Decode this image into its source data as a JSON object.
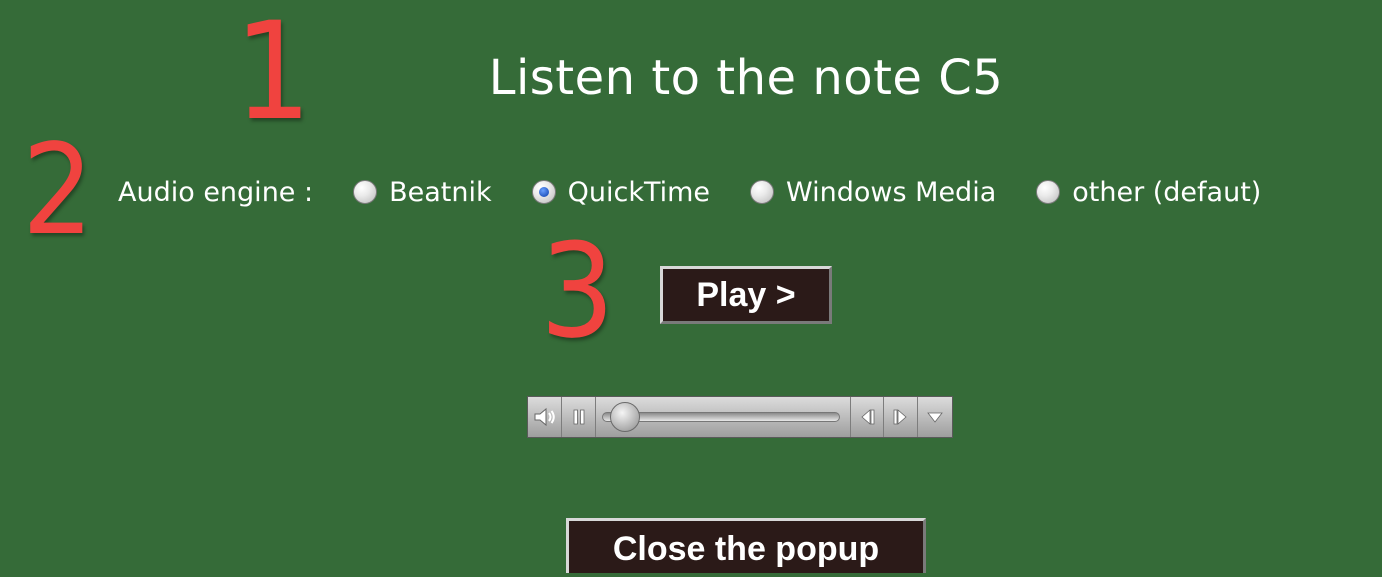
{
  "annotations": [
    "1",
    "2",
    "3"
  ],
  "title": "Listen to the note C5",
  "audio_engine": {
    "label": "Audio engine :",
    "options": [
      {
        "label": "Beatnik",
        "checked": false
      },
      {
        "label": "QuickTime",
        "checked": true
      },
      {
        "label": "Windows Media",
        "checked": false
      },
      {
        "label": "other (defaut)",
        "checked": false
      }
    ]
  },
  "play_button": "Play >",
  "player": {
    "position_fraction": 0.03,
    "controls": [
      "volume-icon",
      "pause-icon",
      "step-back-icon",
      "step-forward-icon",
      "menu-down-icon"
    ]
  },
  "close_button": "Close the popup",
  "colors": {
    "background": "#356b38",
    "annotation": "#f0433f",
    "button_bg": "#2b1a18"
  }
}
